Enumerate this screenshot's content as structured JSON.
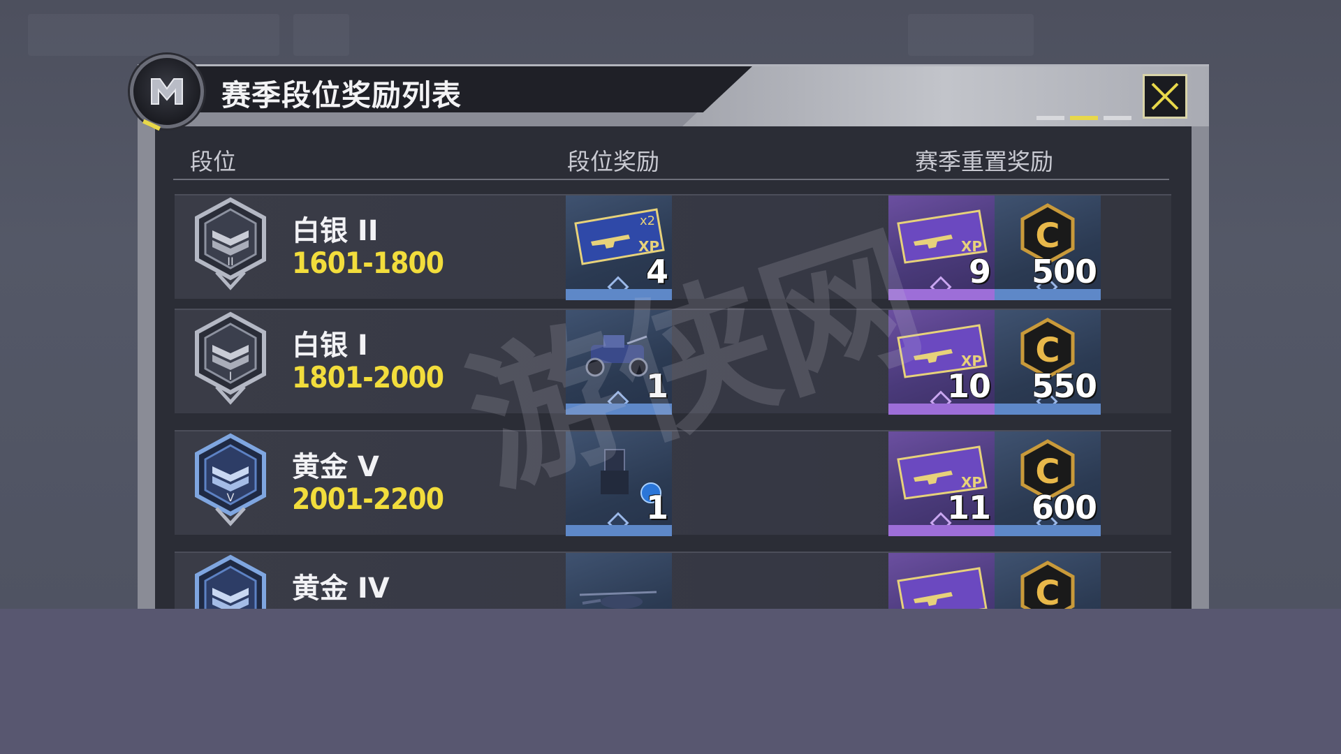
{
  "dialog": {
    "title": "赛季段位奖励列表",
    "close_icon": "close-x-icon",
    "logo_icon": "game-m-logo-icon",
    "page_indicator": {
      "pages": 3,
      "active_index": 1
    }
  },
  "columns": {
    "rank": "段位",
    "rank_reward": "段位奖励",
    "reset_reward": "赛季重置奖励"
  },
  "rows": [
    {
      "name": "白银 II",
      "range": "1601-1800",
      "badge_icon": "silver-2-rank-badge-icon",
      "rank_reward": {
        "icon": "double-xp-weapon-card-icon",
        "count": "4"
      },
      "reset_rewards": [
        {
          "icon": "weapon-xp-card-icon",
          "count": "9"
        },
        {
          "icon": "cod-credits-icon",
          "count": "500"
        }
      ]
    },
    {
      "name": "白银 I",
      "range": "1801-2000",
      "badge_icon": "silver-1-rank-badge-icon",
      "rank_reward": {
        "icon": "vehicle-skin-icon",
        "count": "1"
      },
      "reset_rewards": [
        {
          "icon": "weapon-xp-card-icon",
          "count": "10"
        },
        {
          "icon": "cod-credits-icon",
          "count": "550"
        }
      ]
    },
    {
      "name": "黄金 V",
      "range": "2001-2200",
      "badge_icon": "gold-5-rank-badge-icon",
      "rank_reward": {
        "icon": "scorestreak-skin-icon",
        "count": "1"
      },
      "reset_rewards": [
        {
          "icon": "weapon-xp-card-icon",
          "count": "11"
        },
        {
          "icon": "cod-credits-icon",
          "count": "600"
        }
      ]
    },
    {
      "name": "黄金 IV",
      "range": "",
      "badge_icon": "gold-4-rank-badge-icon",
      "rank_reward": {
        "icon": "helicopter-skin-icon",
        "count": ""
      },
      "reset_rewards": [
        {
          "icon": "weapon-xp-card-icon",
          "count": ""
        },
        {
          "icon": "cod-credits-icon",
          "count": ""
        }
      ]
    }
  ],
  "colors": {
    "accent_yellow": "#f2dd3c",
    "tile_blue": "#5e88c8",
    "tile_purple": "#9d6ed8",
    "panel_dark": "#2b2d36"
  },
  "watermark_text": "游侠网"
}
